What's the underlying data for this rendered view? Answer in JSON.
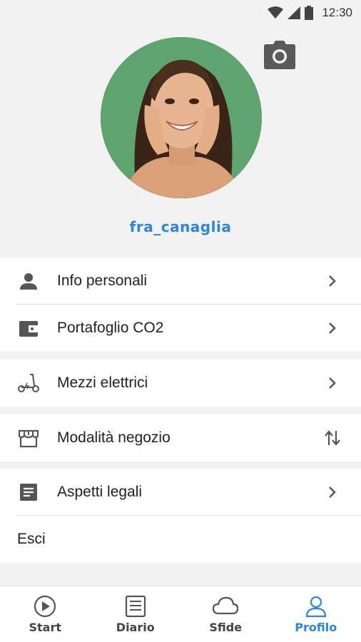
{
  "status_bar": {
    "time": "12:30"
  },
  "profile": {
    "username": "fra_canaglia"
  },
  "menu": {
    "info_personali": "Info personali",
    "portafoglio": "Portafoglio CO2",
    "mezzi": "Mezzi elettrici",
    "modalita": "Modalità negozio",
    "legali": "Aspetti legali",
    "esci": "Esci"
  },
  "bottom_nav": {
    "start": "Start",
    "diario": "Diario",
    "sfide": "Sfide",
    "profilo": "Profilo",
    "active": "profilo"
  },
  "colors": {
    "accent": "#2a86e0",
    "background": "#f2f2f2",
    "icon_gray": "#555555"
  }
}
